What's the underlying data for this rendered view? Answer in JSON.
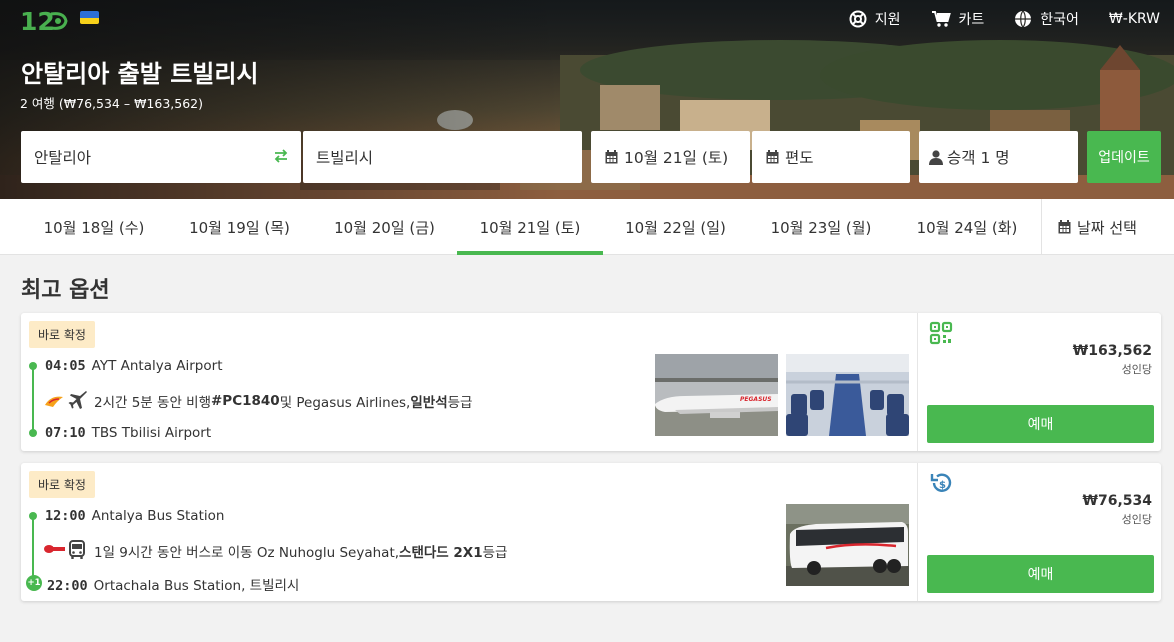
{
  "header": {
    "logo_text": "12",
    "flag": "ukraine-flag",
    "nav": [
      {
        "label": "지원",
        "icon": "lifebuoy-icon"
      },
      {
        "label": "카트",
        "icon": "cart-icon"
      },
      {
        "label": "한국어",
        "icon": "globe-icon"
      },
      {
        "label": "₩-KRW",
        "icon": ""
      }
    ]
  },
  "hero": {
    "title": "안탈리아 출발 트빌리시",
    "subtitle": "2 여행 (₩76,534 – ₩163,562)"
  },
  "search": {
    "from": "안탈리아",
    "to": "트빌리시",
    "date": "10월 21일 (토)",
    "return": "편도",
    "passengers": "승객 1 명",
    "update_label": "업데이트"
  },
  "dates": {
    "tabs": [
      {
        "label": "10월 18일 (수)",
        "active": false
      },
      {
        "label": "10월 19일 (목)",
        "active": false
      },
      {
        "label": "10월 20일 (금)",
        "active": false
      },
      {
        "label": "10월 21일 (토)",
        "active": true
      },
      {
        "label": "10월 22일 (일)",
        "active": false
      },
      {
        "label": "10월 23일 (월)",
        "active": false
      },
      {
        "label": "10월 24일 (화)",
        "active": false
      }
    ],
    "picker_label": "날짜 선택"
  },
  "results": {
    "section_title": "최고 옵션",
    "items": [
      {
        "badge": "바로 확정",
        "dep_time": "04:05",
        "dep_place": "AYT Antalya Airport",
        "desc_pre": "2시간 5분 동안 비행 ",
        "desc_code": "#PC1840",
        "desc_mid": " 및 Pegasus Airlines, ",
        "desc_class": "일반석",
        "desc_post": "등급",
        "arr_time": "07:10",
        "arr_place": "TBS Tbilisi Airport",
        "price": "₩163,562",
        "per": "성인당",
        "book_label": "예매",
        "feature_icon": "qr-ticket-icon",
        "mode_icon": "plane-icon",
        "photo_text": "PEGASUS"
      },
      {
        "badge": "바로 확정",
        "dep_time": "12:00",
        "dep_place": "Antalya Bus Station",
        "desc_pre": "1일 9시간 동안 버스로 이동 Oz Nuhoglu Seyahat, ",
        "desc_code": "스탠다드 2X1",
        "desc_mid": "",
        "desc_class": "",
        "desc_post": " 등급",
        "arr_time": "22:00",
        "arr_place": "Ortachala Bus Station, 트빌리시",
        "day_offset": "+1",
        "price": "₩76,534",
        "per": "성인당",
        "book_label": "예매",
        "feature_icon": "refund-icon",
        "mode_icon": "bus-icon"
      }
    ]
  },
  "colors": {
    "accent": "#49b850",
    "badge_bg": "#fdebc7"
  }
}
